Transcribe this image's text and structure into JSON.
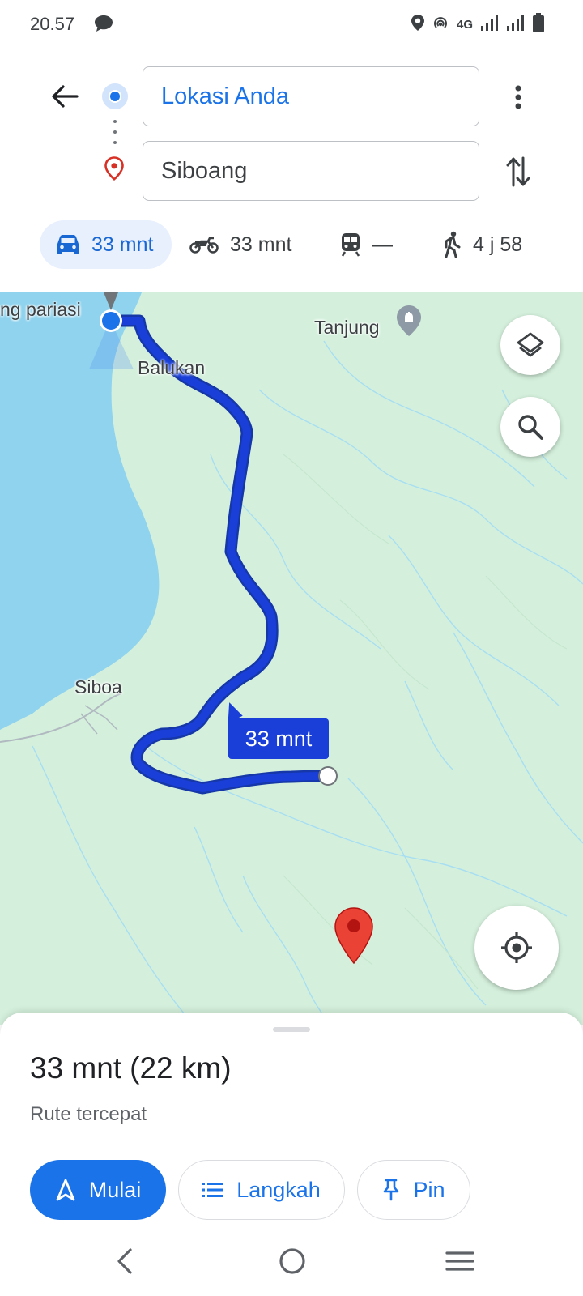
{
  "status_bar": {
    "time": "20.57",
    "network": "4G",
    "icons": [
      "chat-icon",
      "location-icon",
      "hotspot-icon",
      "signal-icon",
      "signal-icon",
      "battery-icon"
    ]
  },
  "directions": {
    "origin": "Lokasi Anda",
    "destination": "Siboang",
    "icons": [
      "back-arrow-icon",
      "origin-dot-icon",
      "destination-pin-icon",
      "more-vert-icon",
      "swap-icon"
    ]
  },
  "modes": [
    {
      "name": "car",
      "icon": "car-icon",
      "label": "33 mnt",
      "active": true
    },
    {
      "name": "motorcycle",
      "icon": "motorcycle-icon",
      "label": "33 mnt",
      "active": false
    },
    {
      "name": "transit",
      "icon": "train-icon",
      "label": "—",
      "active": false
    },
    {
      "name": "walk",
      "icon": "walk-icon",
      "label": "4 j 58",
      "active": false
    }
  ],
  "map": {
    "labels": {
      "pariasi": "ng pariasi",
      "balukan": "Balukan",
      "tanjung": "Tanjung",
      "siboa": "Siboa"
    },
    "route_duration": "33 mnt",
    "route_color": "#1a3fd8",
    "icons": [
      "layers-icon",
      "search-icon",
      "my-location-icon",
      "destination-marker-icon"
    ]
  },
  "sheet": {
    "duration": "33 mnt",
    "distance": "(22 km)",
    "subtitle": "Rute tercepat",
    "start_label": "Mulai",
    "steps_label": "Langkah",
    "pin_label": "Pin"
  },
  "accent_color": "#1a73e8"
}
